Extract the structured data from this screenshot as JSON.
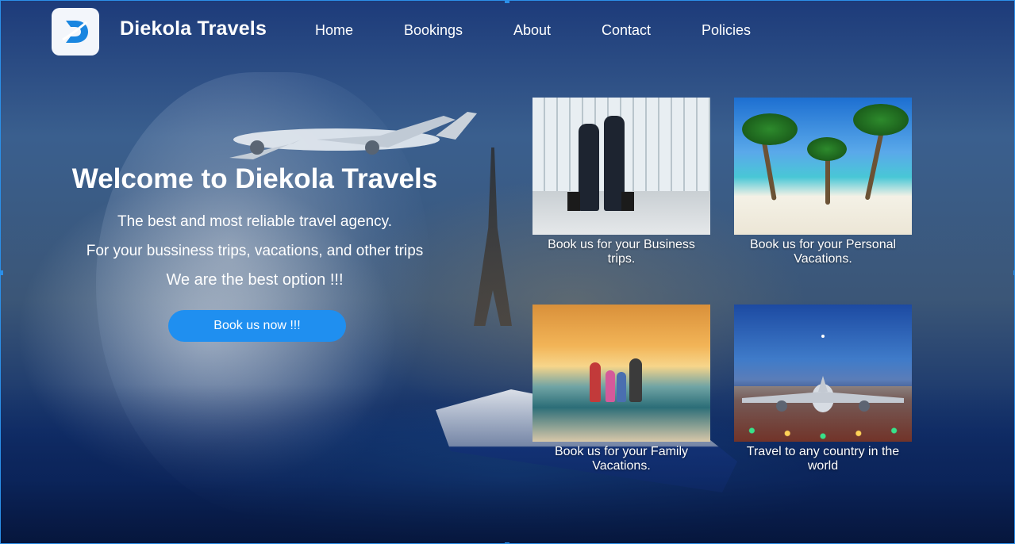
{
  "brand": {
    "name": "Diekola Travels",
    "logo_icon": "d-letter-logo-icon"
  },
  "nav": {
    "items": [
      "Home",
      "Bookings",
      "About",
      "Contact",
      "Policies"
    ]
  },
  "welcome": {
    "title": "Welcome to Diekola Travels",
    "line1": "The best and most reliable travel agency.",
    "line2": "For your bussiness trips, vacations, and other trips",
    "line3": "We are the best option !!!",
    "cta": "Book us now !!!"
  },
  "cards": [
    {
      "caption": "Book us for your Business trips.",
      "image": "business-travelers-image"
    },
    {
      "caption": "Book us for your Personal Vacations.",
      "image": "tropical-beach-image"
    },
    {
      "caption": "Book us for your Family Vacations.",
      "image": "family-beach-sunset-image"
    },
    {
      "caption": "Travel to any country in the world",
      "image": "airplane-runway-image"
    }
  ],
  "colors": {
    "accent": "#1f8ff0",
    "background": "#1d3b7a",
    "text": "#ffffff"
  }
}
